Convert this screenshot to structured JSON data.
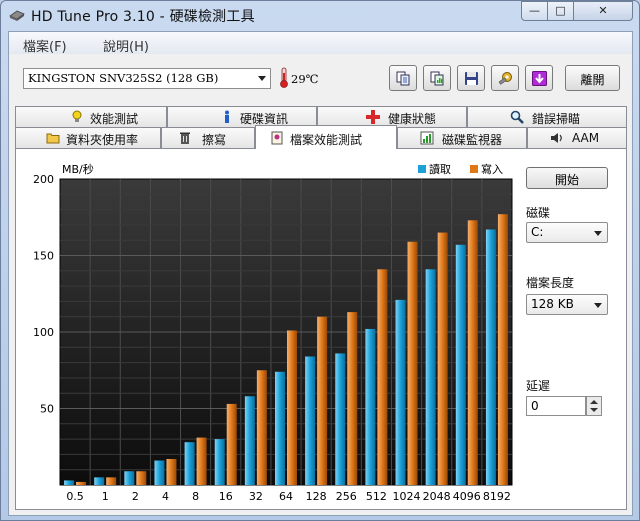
{
  "window": {
    "title": "HD Tune Pro 3.10 - 硬碟檢測工具",
    "controls": {
      "minimize": "—",
      "maximize": "□",
      "close": "✕"
    }
  },
  "menu": {
    "items": [
      "檔案(F)",
      "說明(H)"
    ]
  },
  "toolbar": {
    "drive": "KINGSTON SNV325S2 (128 GB)",
    "temperature": "29℃",
    "buttons": [
      "copy-info",
      "copy-screenshot",
      "save",
      "options",
      "download"
    ],
    "exit_label": "離開"
  },
  "tabs": {
    "row1": [
      "效能測試",
      "硬碟資訊",
      "健康狀態",
      "錯誤掃瞄"
    ],
    "row2": [
      "資料夾使用率",
      "擦寫",
      "檔案效能測試",
      "磁碟監視器",
      "AAM"
    ],
    "active": "檔案效能測試"
  },
  "side": {
    "start_label": "開始",
    "drive_label": "磁碟",
    "drive_value": "C:",
    "length_label": "檔案長度",
    "length_value": "128 KB",
    "delay_label": "延遲",
    "delay_value": "0"
  },
  "colors": {
    "read": "#1ba0d8",
    "write": "#e07818",
    "plot_bg": "#1a1a1a",
    "accent": "#d8282a"
  },
  "chart_data": {
    "type": "bar",
    "ylabel": "MB/秒",
    "ylim": [
      0,
      200
    ],
    "yticks": [
      50,
      100,
      150,
      200
    ],
    "grid": true,
    "legend_position": "top-right",
    "categories": [
      "0.5",
      "1",
      "2",
      "4",
      "8",
      "16",
      "32",
      "64",
      "128",
      "256",
      "512",
      "1024",
      "2048",
      "4096",
      "8192"
    ],
    "series": [
      {
        "name": "讀取",
        "values": [
          3,
          5,
          9,
          16,
          28,
          30,
          58,
          74,
          84,
          86,
          102,
          121,
          141,
          157,
          167
        ]
      },
      {
        "name": "寫入",
        "values": [
          2,
          5,
          9,
          17,
          31,
          53,
          75,
          101,
          110,
          113,
          141,
          159,
          165,
          173,
          177
        ]
      }
    ]
  }
}
